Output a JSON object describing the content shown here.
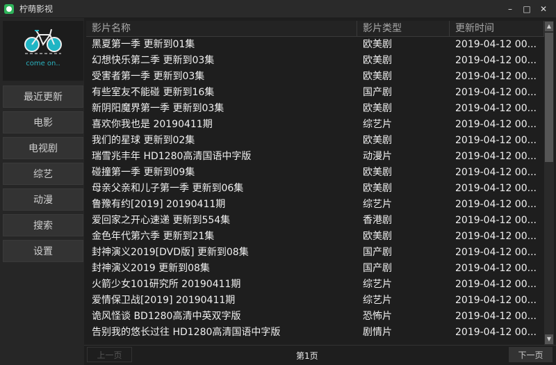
{
  "app": {
    "title": "柠萌影视",
    "logo_text": "come on..",
    "minimize": "–",
    "maximize": "□",
    "close": "✕"
  },
  "sidebar": {
    "items": [
      {
        "label": "最近更新"
      },
      {
        "label": "电影"
      },
      {
        "label": "电视剧"
      },
      {
        "label": "综艺"
      },
      {
        "label": "动漫"
      },
      {
        "label": "搜索"
      },
      {
        "label": "设置"
      }
    ]
  },
  "table": {
    "headers": [
      "影片名称",
      "影片类型",
      "更新时间"
    ],
    "rows": [
      [
        "黑夏第一季 更新到01集",
        "欧美剧",
        "2019-04-12 00..."
      ],
      [
        "幻想快乐第二季 更新到03集",
        "欧美剧",
        "2019-04-12 00..."
      ],
      [
        "受害者第一季 更新到03集",
        "欧美剧",
        "2019-04-12 00..."
      ],
      [
        "有些室友不能碰 更新到16集",
        "国产剧",
        "2019-04-12 00..."
      ],
      [
        "新阴阳魔界第一季 更新到03集",
        "欧美剧",
        "2019-04-12 00..."
      ],
      [
        "喜欢你我也是 20190411期",
        "综艺片",
        "2019-04-12 00..."
      ],
      [
        "我们的星球 更新到02集",
        "欧美剧",
        "2019-04-12 00..."
      ],
      [
        "瑞雪兆丰年 HD1280高清国语中字版",
        "动漫片",
        "2019-04-12 00..."
      ],
      [
        "碰撞第一季 更新到09集",
        "欧美剧",
        "2019-04-12 00..."
      ],
      [
        "母亲父亲和儿子第一季 更新到06集",
        "欧美剧",
        "2019-04-12 00..."
      ],
      [
        "鲁豫有约[2019] 20190411期",
        "综艺片",
        "2019-04-12 00..."
      ],
      [
        "爱回家之开心速递 更新到554集",
        "香港剧",
        "2019-04-12 00..."
      ],
      [
        "金色年代第六季 更新到21集",
        "欧美剧",
        "2019-04-12 00..."
      ],
      [
        "封神演义2019[DVD版] 更新到08集",
        "国产剧",
        "2019-04-12 00..."
      ],
      [
        "封神演义2019 更新到08集",
        "国产剧",
        "2019-04-12 00..."
      ],
      [
        "火箭少女101研究所 20190411期",
        "综艺片",
        "2019-04-12 00..."
      ],
      [
        "爱情保卫战[2019] 20190411期",
        "综艺片",
        "2019-04-12 00..."
      ],
      [
        "诡风怪谈 BD1280高清中英双字版",
        "恐怖片",
        "2019-04-12 00..."
      ],
      [
        "告别我的悠长过往 HD1280高清国语中字版",
        "剧情片",
        "2019-04-12 00..."
      ]
    ]
  },
  "pager": {
    "prev": "上一页",
    "page": "第1页",
    "next": "下一页"
  }
}
